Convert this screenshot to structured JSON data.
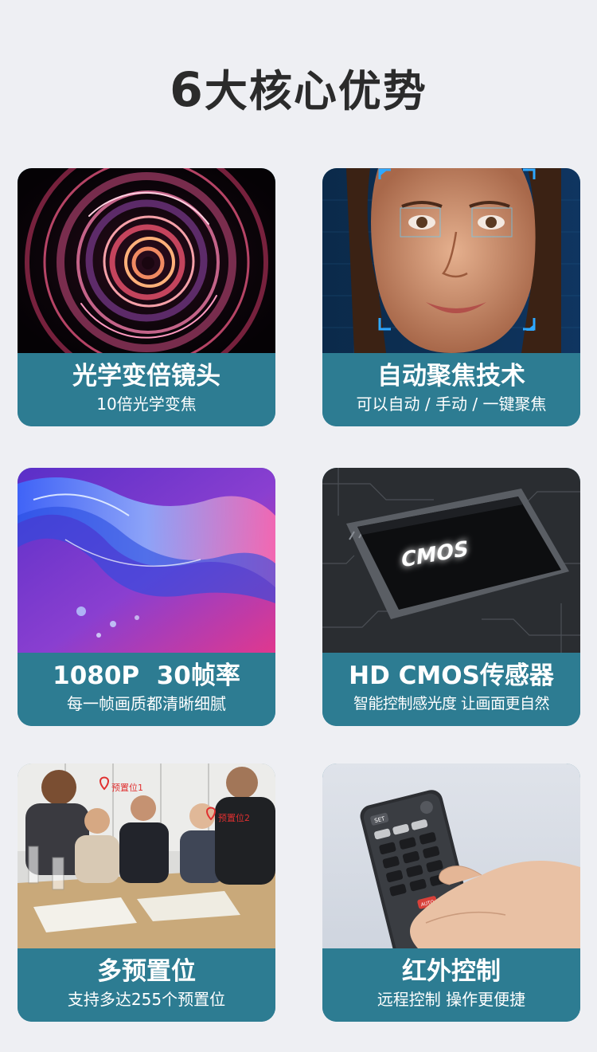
{
  "header": {
    "number": "6",
    "title": "大核心优势"
  },
  "features": [
    {
      "title": "光学变倍镜头",
      "subtitle": "10倍光学变焦",
      "image": "lens-rings-image"
    },
    {
      "title": "自动聚焦技术",
      "subtitle": "可以自动 / 手动 / 一键聚焦",
      "image": "face-focus-image"
    },
    {
      "title": "1080P  30帧率",
      "subtitle": "每一帧画质都清晰细腻",
      "image": "water-splash-image"
    },
    {
      "title": "HD CMOS传感器",
      "subtitle": "智能控制感光度 让画面更自然",
      "image": "cmos-chip-image",
      "chip_label": "CMOS"
    },
    {
      "title": "多预置位",
      "subtitle": "支持多达255个预置位",
      "image": "meeting-room-image",
      "tags": [
        "预置位1",
        "预置位2"
      ]
    },
    {
      "title": "红外控制",
      "subtitle": "远程控制 操作更便捷",
      "image": "remote-control-image",
      "remote_keys": [
        "SET",
        "AUTO"
      ]
    }
  ],
  "colors": {
    "caption_bg": "#2d7c92",
    "page_bg": "#eeeff3",
    "title_text": "#2b2b2b"
  }
}
